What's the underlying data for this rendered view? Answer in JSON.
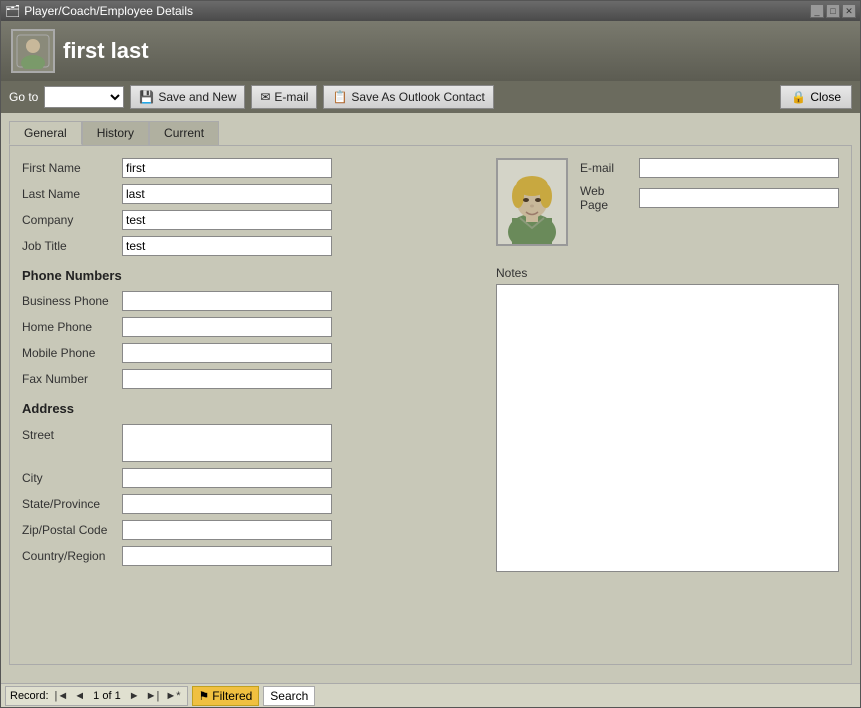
{
  "titleBar": {
    "title": "Player/Coach/Employee Details",
    "controls": [
      "minimize",
      "maximize",
      "close"
    ]
  },
  "header": {
    "icon": "person-icon",
    "title": "first last"
  },
  "toolbar": {
    "goto_label": "Go to",
    "goto_options": [
      ""
    ],
    "save_new_label": "Save and New",
    "email_label": "E-mail",
    "save_outlook_label": "Save As Outlook Contact",
    "close_label": "Close"
  },
  "tabs": {
    "items": [
      {
        "label": "General",
        "active": true
      },
      {
        "label": "History",
        "active": false
      },
      {
        "label": "Current",
        "active": false
      }
    ]
  },
  "form": {
    "fields": {
      "first_name_label": "First Name",
      "first_name_value": "first",
      "last_name_label": "Last Name",
      "last_name_value": "last",
      "company_label": "Company",
      "company_value": "test",
      "job_title_label": "Job Title",
      "job_title_value": "test",
      "email_label": "E-mail",
      "email_value": "",
      "web_page_label": "Web Page",
      "web_page_value": ""
    },
    "phone_section": {
      "header": "Phone Numbers",
      "business_phone_label": "Business Phone",
      "business_phone_value": "",
      "home_phone_label": "Home Phone",
      "home_phone_value": "",
      "mobile_phone_label": "Mobile Phone",
      "mobile_phone_value": "",
      "fax_number_label": "Fax Number",
      "fax_number_value": ""
    },
    "address_section": {
      "header": "Address",
      "street_label": "Street",
      "street_value": "",
      "city_label": "City",
      "city_value": "",
      "state_label": "State/Province",
      "state_value": "",
      "zip_label": "Zip/Postal Code",
      "zip_value": "",
      "country_label": "Country/Region",
      "country_value": ""
    },
    "notes_label": "Notes",
    "notes_value": ""
  },
  "statusBar": {
    "record_label": "Record:",
    "first_btn": "|◄",
    "prev_btn": "◄",
    "record_text": "1 of 1",
    "next_btn": "►",
    "last_btn": "►|",
    "new_btn": "►*",
    "filtered_label": "Filtered",
    "search_label": "Search"
  }
}
